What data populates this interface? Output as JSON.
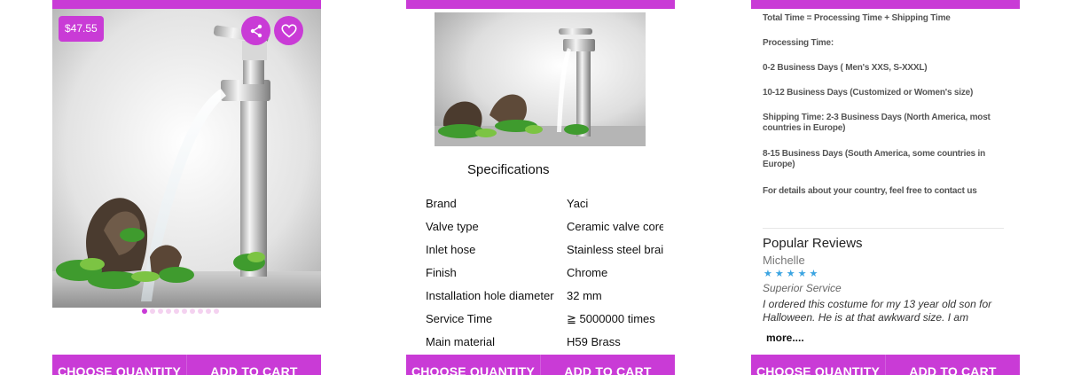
{
  "colors": {
    "accent": "#c93bd6",
    "dot_inactive": "#f4d2f0",
    "star": "#3ba4e1"
  },
  "screen1": {
    "price": "$47.55",
    "image_count": 10,
    "active_image_index": 0
  },
  "screen2": {
    "spec_title": "Specifications",
    "specs": [
      {
        "key": "Brand",
        "value": "Yaci"
      },
      {
        "key": "Valve type",
        "value": "Ceramic valve core"
      },
      {
        "key": "Inlet hose",
        "value": "Stainless steel braided hose"
      },
      {
        "key": "Finish",
        "value": "Chrome"
      },
      {
        "key": "Installation  hole diameter",
        "value": "32 mm"
      },
      {
        "key": "Service Time",
        "value": "≧ 5000000 times"
      },
      {
        "key": "Main material",
        "value": "H59 Brass"
      }
    ]
  },
  "screen3": {
    "shipping_lines": [
      "Total Time = Processing Time + Shipping Time",
      "Processing Time:",
      "0-2 Business Days ( Men's XXS, S-XXXL)",
      "10-12 Business Days (Customized or Women's size)",
      "Shipping Time: 2-3 Business Days (North America, most countries in Europe)",
      "8-15 Business Days (South America, some countries in Europe)",
      "For details about your country, feel free to contact us"
    ],
    "reviews_title": "Popular Reviews",
    "review": {
      "author": "Michelle",
      "stars": "★★★★★",
      "rating": 5,
      "subject": "Superior Service",
      "body": "I ordered this costume for my 13 year old son for Halloween. He is at that awkward size. I am",
      "more": "more...."
    }
  },
  "actions": {
    "choose_quantity": "CHOOSE QUANTITY",
    "add_to_cart": "ADD TO CART"
  }
}
